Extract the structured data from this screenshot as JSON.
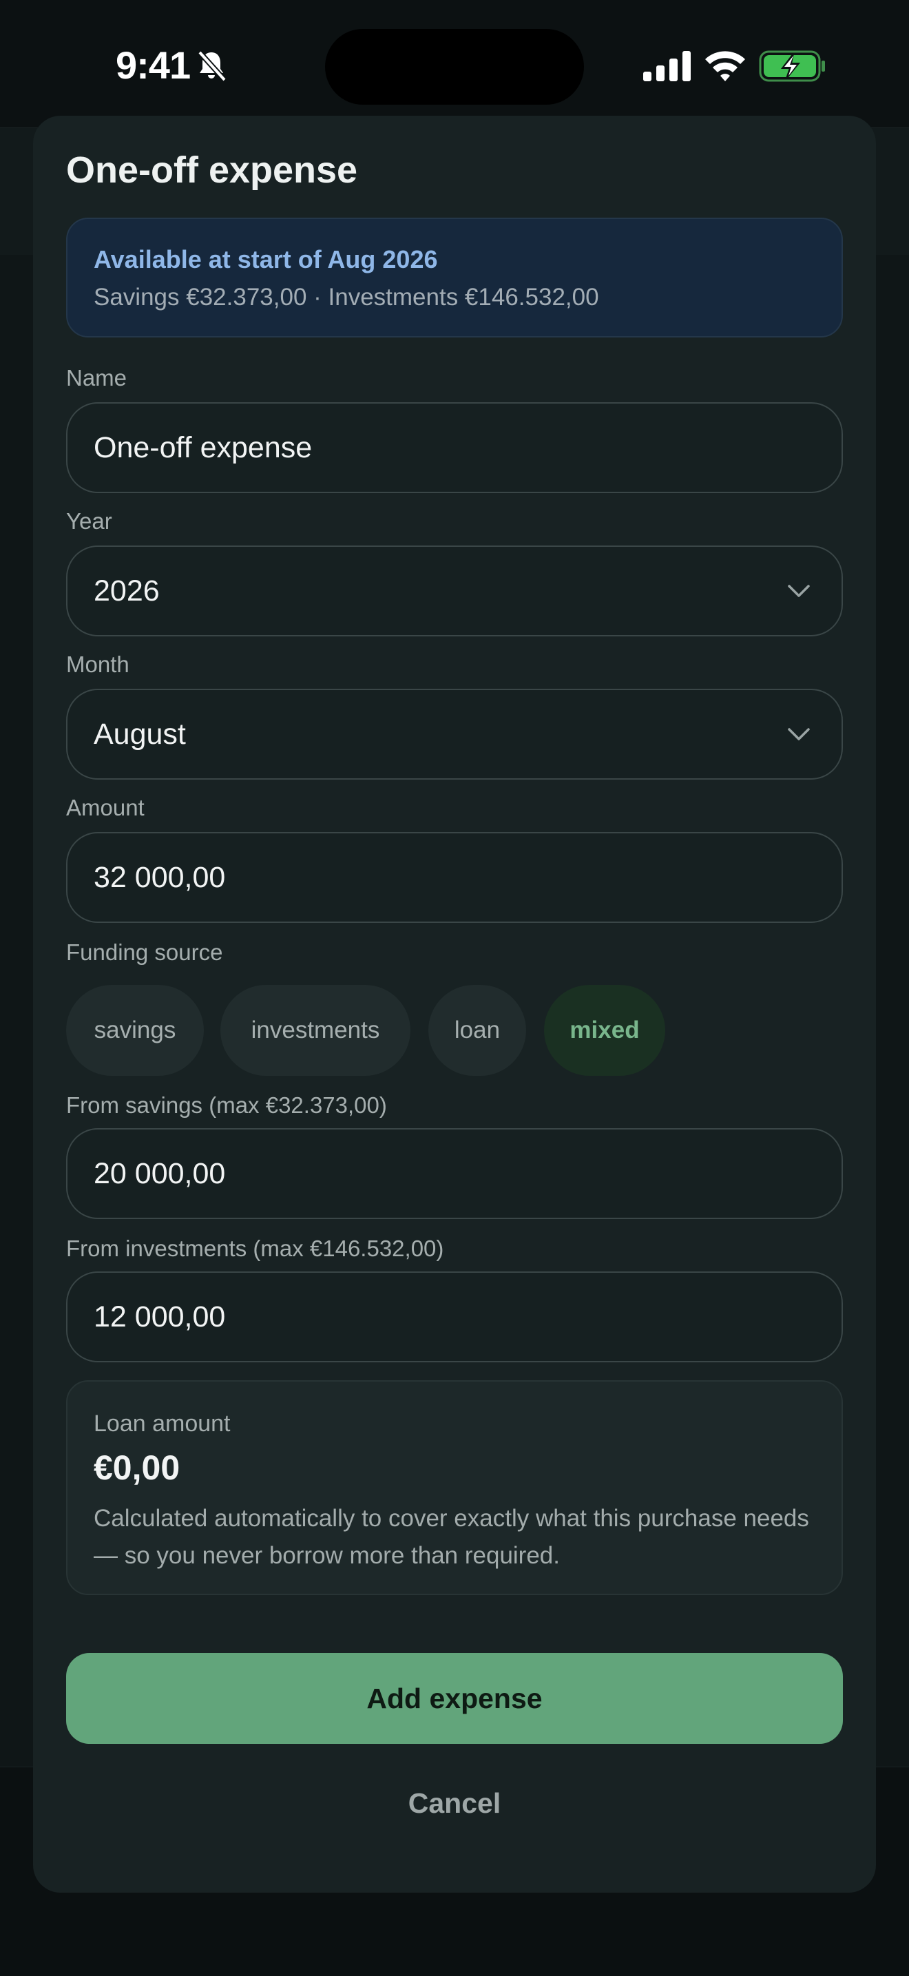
{
  "status_bar": {
    "time": "9:41",
    "icons": [
      "bell-slash-icon",
      "cellular-signal-icon",
      "wifi-icon",
      "battery-charging-icon"
    ]
  },
  "sheet": {
    "title": "One-off expense",
    "availability": {
      "title": "Available at start of Aug 2026",
      "subtitle": "Savings €32.373,00 · Investments €146.532,00"
    },
    "name": {
      "label": "Name",
      "value": "One-off expense"
    },
    "year": {
      "label": "Year",
      "value": "2026"
    },
    "month": {
      "label": "Month",
      "value": "August"
    },
    "amount": {
      "label": "Amount",
      "value": "32 000,00"
    },
    "funding": {
      "label": "Funding source",
      "options": [
        "savings",
        "investments",
        "loan",
        "mixed"
      ],
      "selected": "mixed"
    },
    "from_savings": {
      "label": "From savings (max €32.373,00)",
      "value": "20 000,00"
    },
    "from_investments": {
      "label": "From investments (max €146.532,00)",
      "value": "12 000,00"
    },
    "loan": {
      "label": "Loan amount",
      "amount": "€0,00",
      "note": "Calculated automatically to cover exactly what this purchase needs — so you never borrow more than required."
    },
    "actions": {
      "add_label": "Add expense",
      "cancel_label": "Cancel"
    }
  },
  "colors": {
    "accent": "#62a57b",
    "info_background": "#16283d",
    "info_title": "#8fb7e8",
    "sheet_background": "#182223"
  }
}
